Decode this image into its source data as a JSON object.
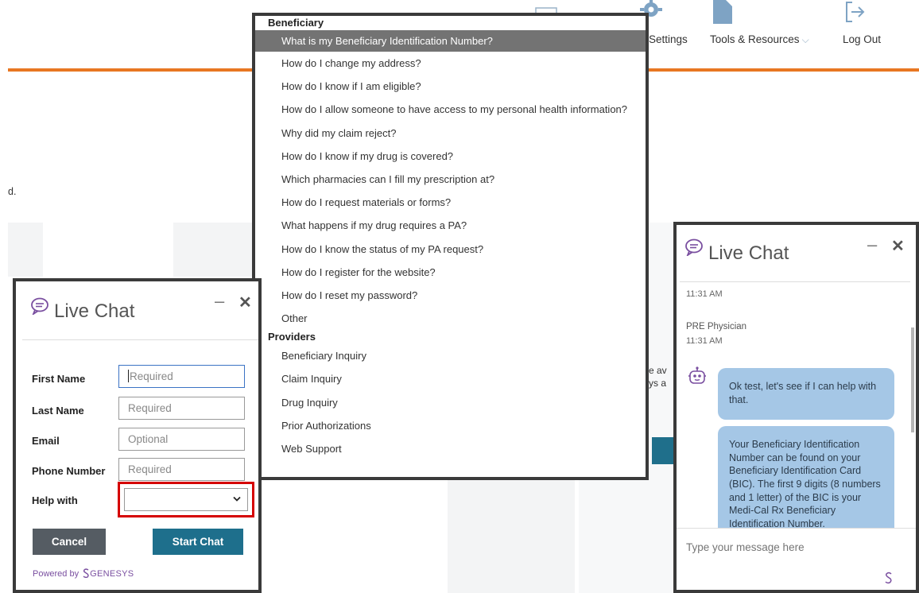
{
  "site": {
    "nav": [
      {
        "label": "Settings",
        "icon": "gear-icon"
      },
      {
        "label": "Tools & Resources",
        "icon": "document-icon"
      },
      {
        "label": "Log Out",
        "icon": "logout-icon"
      }
    ],
    "fragments": {
      "period": "d."
    }
  },
  "help_menu": {
    "groups": [
      {
        "label": "Beneficiary",
        "options": [
          "What is my Beneficiary Identification Number?",
          "How do I change my address?",
          "How do I know if I am eligible?",
          "How do I allow someone to have access to my personal health information?",
          "Why did my claim reject?",
          "How do I know if my drug is covered?",
          "Which pharmacies can I fill my prescription at?",
          "How do I request materials or forms?",
          "What happens if my drug requires a PA?",
          "How do I know the status of my PA request?",
          "How do I register for the website?",
          "How do I reset my password?",
          "Other"
        ]
      },
      {
        "label": "Providers",
        "options": [
          "Beneficiary Inquiry",
          "Claim Inquiry",
          "Drug Inquiry",
          "Prior Authorizations",
          "Web Support"
        ]
      }
    ],
    "selected": "What is my Beneficiary Identification Number?"
  },
  "chat_form": {
    "title": "Live Chat",
    "minimize": "–",
    "close": "✕",
    "fields": {
      "first_name": {
        "label": "First Name",
        "placeholder": "Required"
      },
      "last_name": {
        "label": "Last Name",
        "placeholder": "Required"
      },
      "email": {
        "label": "Email",
        "placeholder": "Optional"
      },
      "phone": {
        "label": "Phone Number",
        "placeholder": "Required"
      },
      "help_with": {
        "label": "Help with",
        "value": ""
      }
    },
    "cancel_label": "Cancel",
    "start_label": "Start Chat",
    "powered_by": "Powered by",
    "brand": "GENESYS",
    "highlight_color": "#d50000"
  },
  "chat_window": {
    "title": "Live Chat",
    "minimize": "–",
    "close": "✕",
    "messages": [
      {
        "time": "11:31 AM"
      },
      {
        "sender": "PRE Physician",
        "time": "11:31 AM"
      },
      {
        "sender": "bot",
        "text": "Ok test, let's see if I can help with that."
      },
      {
        "sender": "bot",
        "text": "Your Beneficiary Identification Number can be found on your Beneficiary Identification Card (BIC). The first 9 digits (8 numbers and 1 letter) of the BIC is your Medi-Cal Rx Beneficiary Identification Number."
      }
    ],
    "input_placeholder": "Type your message here",
    "bubble_color": "#a5c7e6"
  },
  "colors": {
    "accent_orange": "#e87722",
    "primary_button": "#1e6f8c",
    "cancel_button": "#555c63",
    "chat_icon_purple": "#7a4fa0"
  }
}
